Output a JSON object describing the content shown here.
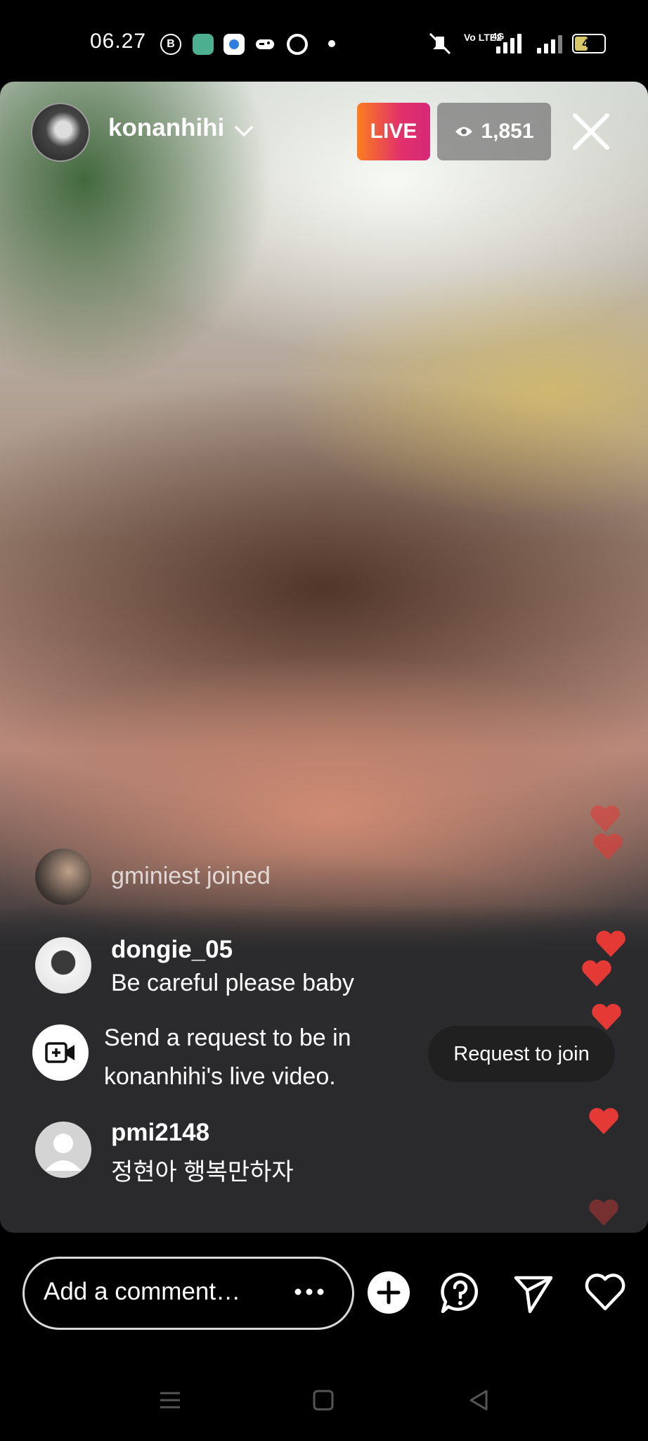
{
  "status_bar": {
    "time": "06.27",
    "battery": "47",
    "network_label": "Vo LTE2",
    "network_type": "4G"
  },
  "live_header": {
    "username": "konanhihi",
    "live_label": "LIVE",
    "viewer_count": "1,851"
  },
  "comments": [
    {
      "type": "join",
      "text": "gminiest joined"
    },
    {
      "type": "comment",
      "username": "dongie_05",
      "text": "Be careful please baby"
    },
    {
      "type": "comment",
      "username": "pmi2148",
      "text": "정현아 행복만하자"
    }
  ],
  "join_request": {
    "line1": "Send a request to be in",
    "line2": "konanhihi's live video.",
    "button_label": "Request to join"
  },
  "comment_bar": {
    "placeholder": "Add a comment…"
  },
  "colors": {
    "live_gradient_start": "#fa7e1e",
    "live_gradient_end": "#d62976",
    "heart": "#e53935"
  },
  "icons": [
    "add-icon",
    "question-icon",
    "send-icon",
    "heart-icon",
    "menu-icon",
    "home-icon",
    "back-icon"
  ]
}
